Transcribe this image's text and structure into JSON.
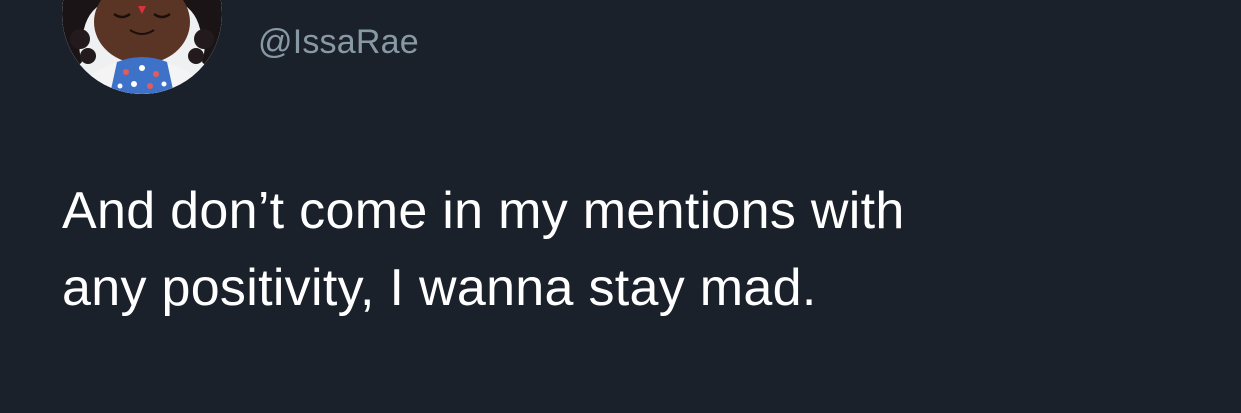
{
  "background_color": "#1b212b",
  "author": {
    "handle": "@IssaRae",
    "avatar_icon": "doll-avatar-icon"
  },
  "tweet": {
    "lines": [
      "And don’t come in my mentions with",
      "any positivity, I wanna stay mad."
    ]
  }
}
